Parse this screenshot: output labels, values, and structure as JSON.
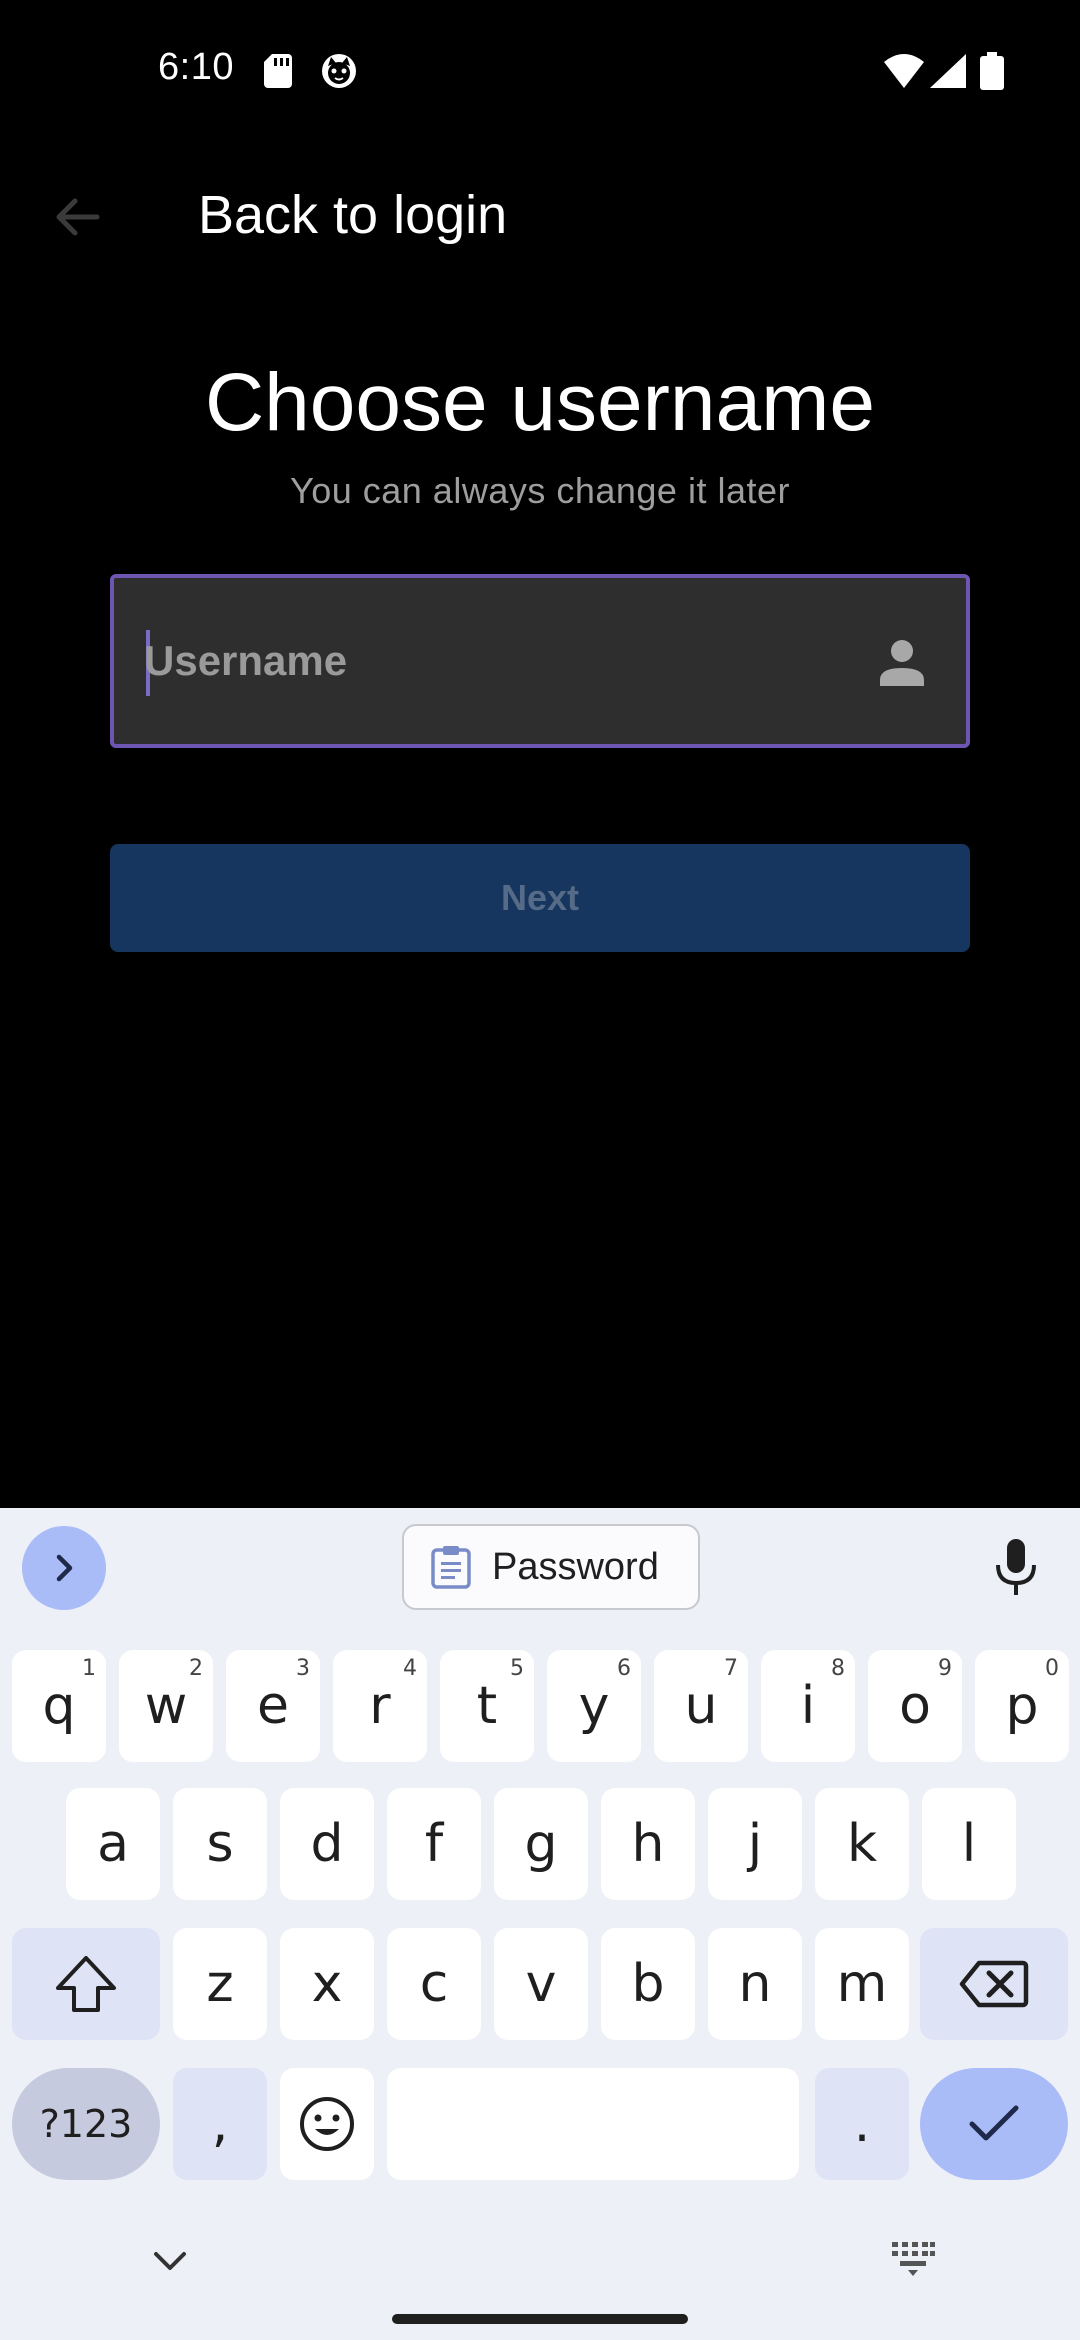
{
  "status_bar": {
    "time": "6:10",
    "icons": [
      "sd-card-icon",
      "cat-notification-icon",
      "wifi-icon",
      "signal-icon",
      "battery-icon"
    ]
  },
  "app_bar": {
    "back_label": "Back to login"
  },
  "heading": {
    "title": "Choose username",
    "subtitle": "You can always change it later"
  },
  "username_field": {
    "placeholder": "Username",
    "value": ""
  },
  "next_button": {
    "label": "Next"
  },
  "keyboard": {
    "suggestion_chip": "Password",
    "row1": [
      {
        "key": "q",
        "hint": "1"
      },
      {
        "key": "w",
        "hint": "2"
      },
      {
        "key": "e",
        "hint": "3"
      },
      {
        "key": "r",
        "hint": "4"
      },
      {
        "key": "t",
        "hint": "5"
      },
      {
        "key": "y",
        "hint": "6"
      },
      {
        "key": "u",
        "hint": "7"
      },
      {
        "key": "i",
        "hint": "8"
      },
      {
        "key": "o",
        "hint": "9"
      },
      {
        "key": "p",
        "hint": "0"
      }
    ],
    "row2": [
      "a",
      "s",
      "d",
      "f",
      "g",
      "h",
      "j",
      "k",
      "l"
    ],
    "row3": [
      "z",
      "x",
      "c",
      "v",
      "b",
      "n",
      "m"
    ],
    "symbols_label": "?123",
    "comma": ",",
    "period": "."
  },
  "colors": {
    "background": "#000000",
    "field_border": "#6d55b2",
    "next_button_bg": "#17365f",
    "keyboard_bg": "#eef0f7",
    "key_accent": "#a9bcf8"
  }
}
